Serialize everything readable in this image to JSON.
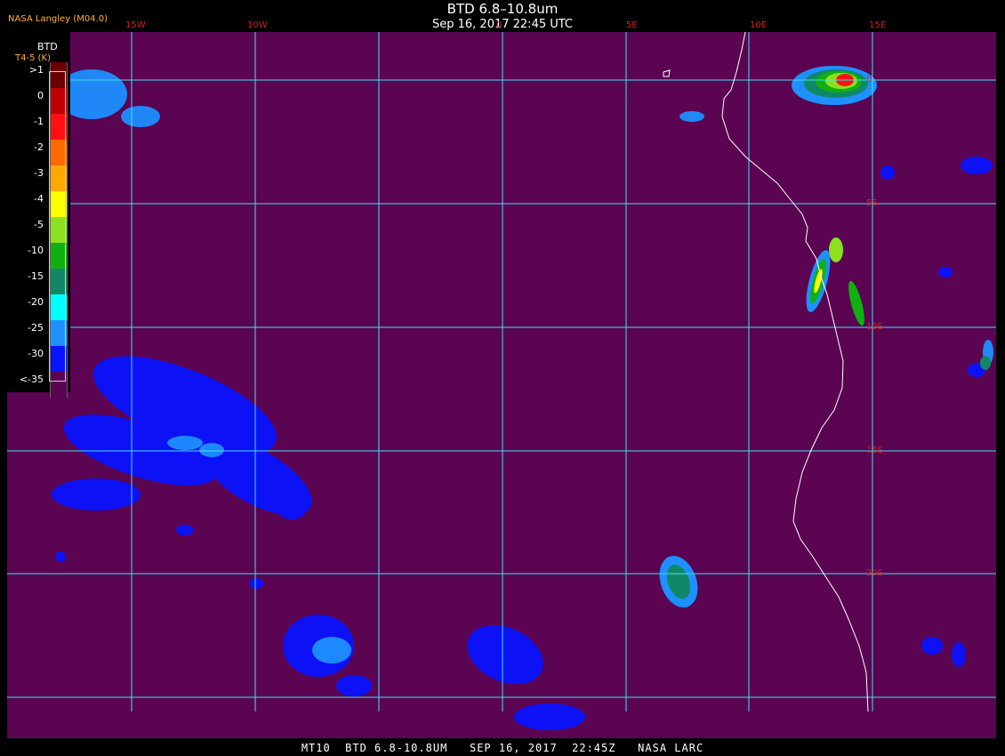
{
  "header": {
    "title": "BTD 6.8–10.8um",
    "timestamp": "Sep 16, 2017 22:45 UTC",
    "branding": "NASA Langley (M04.0)"
  },
  "footer": {
    "caption": "MT10  BTD 6.8-10.8UM   SEP 16, 2017  22:45Z   NASA LARC"
  },
  "longitude_labels": [
    "15W",
    "10W",
    "0",
    "5E",
    "10E",
    "15E"
  ],
  "latitude_labels": [
    "0",
    "5S",
    "10S",
    "15S",
    "20S"
  ],
  "legend": {
    "title": "BTD",
    "subtitle": "T4-5 (K)",
    "entries": [
      {
        "label": ">1",
        "color": "#6a0000"
      },
      {
        "label": "0",
        "color": "#c00000"
      },
      {
        "label": "-1",
        "color": "#ff1010"
      },
      {
        "label": "-2",
        "color": "#ff6a00"
      },
      {
        "label": "-3",
        "color": "#ffa800"
      },
      {
        "label": "-4",
        "color": "#ffff00"
      },
      {
        "label": "-5",
        "color": "#8ce020"
      },
      {
        "label": "-10",
        "color": "#10b010"
      },
      {
        "label": "-15",
        "color": "#108868"
      },
      {
        "label": "-20",
        "color": "#00ffff"
      },
      {
        "label": "-25",
        "color": "#1e90ff"
      },
      {
        "label": "-30",
        "color": "#0a14ff"
      },
      {
        "label": "<-35",
        "color": "#5a0452"
      }
    ]
  },
  "colors": {
    "background": "#5a0452",
    "grid": "#40e0f0",
    "coastline": "#ffffff",
    "tick_labels": "#d02020"
  }
}
